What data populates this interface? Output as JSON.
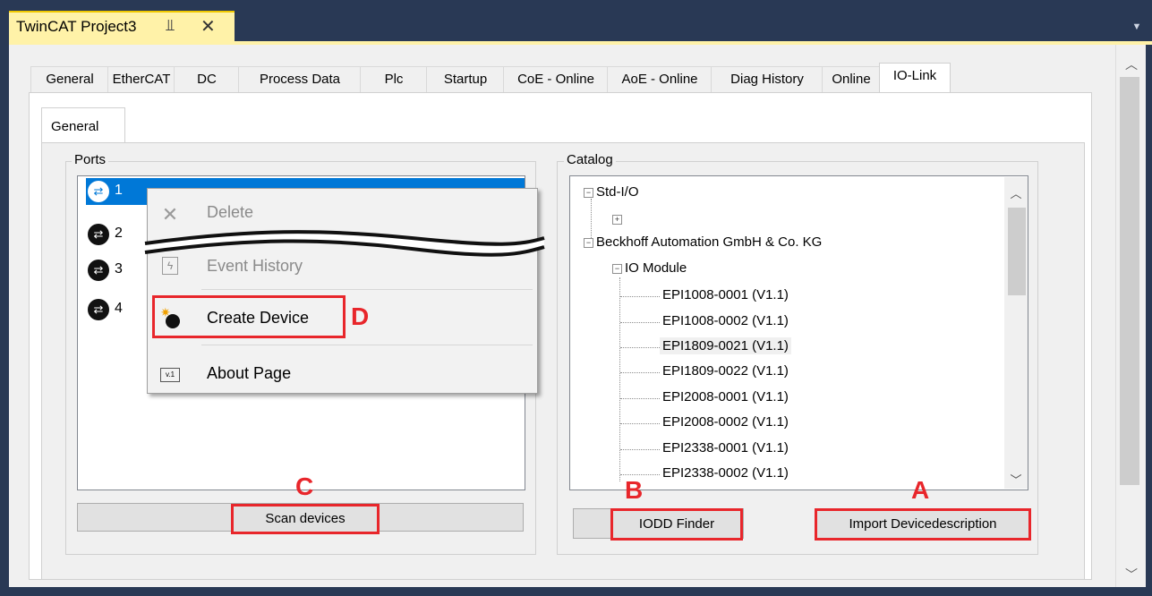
{
  "document_tab": {
    "title": "TwinCAT Project3",
    "pin_icon": "⫫",
    "close_icon": "✕"
  },
  "tabs": [
    "General",
    "EtherCAT",
    "DC",
    "Process Data",
    "Plc",
    "Startup",
    "CoE - Online",
    "AoE - Online",
    "Diag History",
    "Online",
    "IO-Link"
  ],
  "active_tab": "IO-Link",
  "subtab": "General",
  "ports": {
    "label": "Ports",
    "items": [
      "1",
      "2",
      "3",
      "4"
    ],
    "selected": "1",
    "scan_button": "Scan devices"
  },
  "context_menu": {
    "items": [
      {
        "label": "Delete",
        "enabled": false,
        "icon": "delete-x-icon"
      },
      {
        "label": "Event History",
        "enabled": false,
        "icon": "event-history-icon"
      },
      {
        "label": "Create Device",
        "enabled": true,
        "icon": "create-device-icon"
      },
      {
        "label": "About Page",
        "enabled": true,
        "icon": "about-page-icon"
      }
    ]
  },
  "catalog": {
    "label": "Catalog",
    "tree": {
      "std_io": "Std-I/O",
      "vendor": "Beckhoff Automation GmbH & Co. KG",
      "group": "IO Module",
      "modules": [
        "EPI1008-0001 (V1.1)",
        "EPI1008-0002 (V1.1)",
        "EPI1809-0021 (V1.1)",
        "EPI1809-0022 (V1.1)",
        "EPI2008-0001 (V1.1)",
        "EPI2008-0002 (V1.1)",
        "EPI2338-0001 (V1.1)",
        "EPI2338-0002 (V1.1)"
      ],
      "highlighted": "EPI1809-0021 (V1.1)"
    },
    "iodd_button": "IODD Finder",
    "import_button": "Import Devicedescription"
  },
  "annotations": {
    "a": "A",
    "b": "B",
    "c": "C",
    "d": "D",
    "color": "#e8262b"
  }
}
